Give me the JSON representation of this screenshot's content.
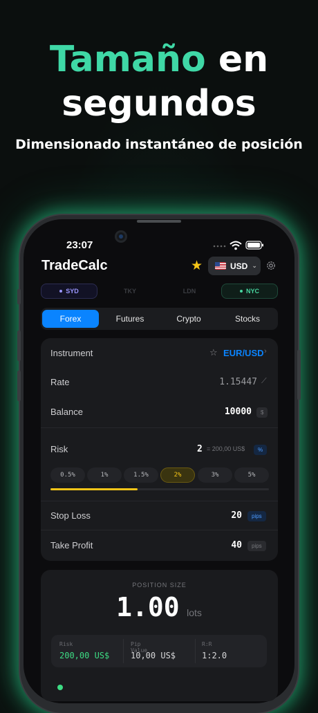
{
  "hero": {
    "title_accent": "Tamaño",
    "title_rest": "en",
    "title_line2": "segundos",
    "subtitle": "Dimensionado instantáneo de posición"
  },
  "status_bar": {
    "time": "23:07"
  },
  "app": {
    "title": "TradeCalc",
    "currency": "USD",
    "colors": {
      "accent_green": "#3fd8a6",
      "primary_blue": "#0a84ff",
      "highlight_yellow": "#f5c518"
    }
  },
  "sessions": [
    {
      "label": "SYD",
      "active": true
    },
    {
      "label": "TKY",
      "active": false
    },
    {
      "label": "LDN",
      "active": false
    },
    {
      "label": "NYC",
      "active": true
    }
  ],
  "tabs": [
    {
      "label": "Forex",
      "active": true
    },
    {
      "label": "Futures",
      "active": false
    },
    {
      "label": "Crypto",
      "active": false
    },
    {
      "label": "Stocks",
      "active": false
    }
  ],
  "form": {
    "instrument": {
      "label": "Instrument",
      "value": "EUR/USD"
    },
    "rate": {
      "label": "Rate",
      "value": "1.15447"
    },
    "balance": {
      "label": "Balance",
      "value": "10000",
      "unit": "$"
    },
    "risk": {
      "label": "Risk",
      "value": "2",
      "equivalent": "= 200,00 US$",
      "unit": "%",
      "slider_fraction": 0.4
    },
    "risk_presets": [
      {
        "label": "0.5%",
        "active": false
      },
      {
        "label": "1%",
        "active": false
      },
      {
        "label": "1.5%",
        "active": false
      },
      {
        "label": "2%",
        "active": true
      },
      {
        "label": "3%",
        "active": false
      },
      {
        "label": "5%",
        "active": false
      }
    ],
    "stop_loss": {
      "label": "Stop Loss",
      "value": "20",
      "unit": "pips"
    },
    "take_profit": {
      "label": "Take Profit",
      "value": "40",
      "unit": "pips"
    }
  },
  "result": {
    "label": "POSITION SIZE",
    "value": "1.00",
    "unit": "lots",
    "stats": [
      {
        "label": "Risk",
        "value": "200,00 US$"
      },
      {
        "label": "Pip Value",
        "value": "10,00 US$"
      },
      {
        "label": "R:R",
        "value": "1:2.0"
      }
    ]
  }
}
